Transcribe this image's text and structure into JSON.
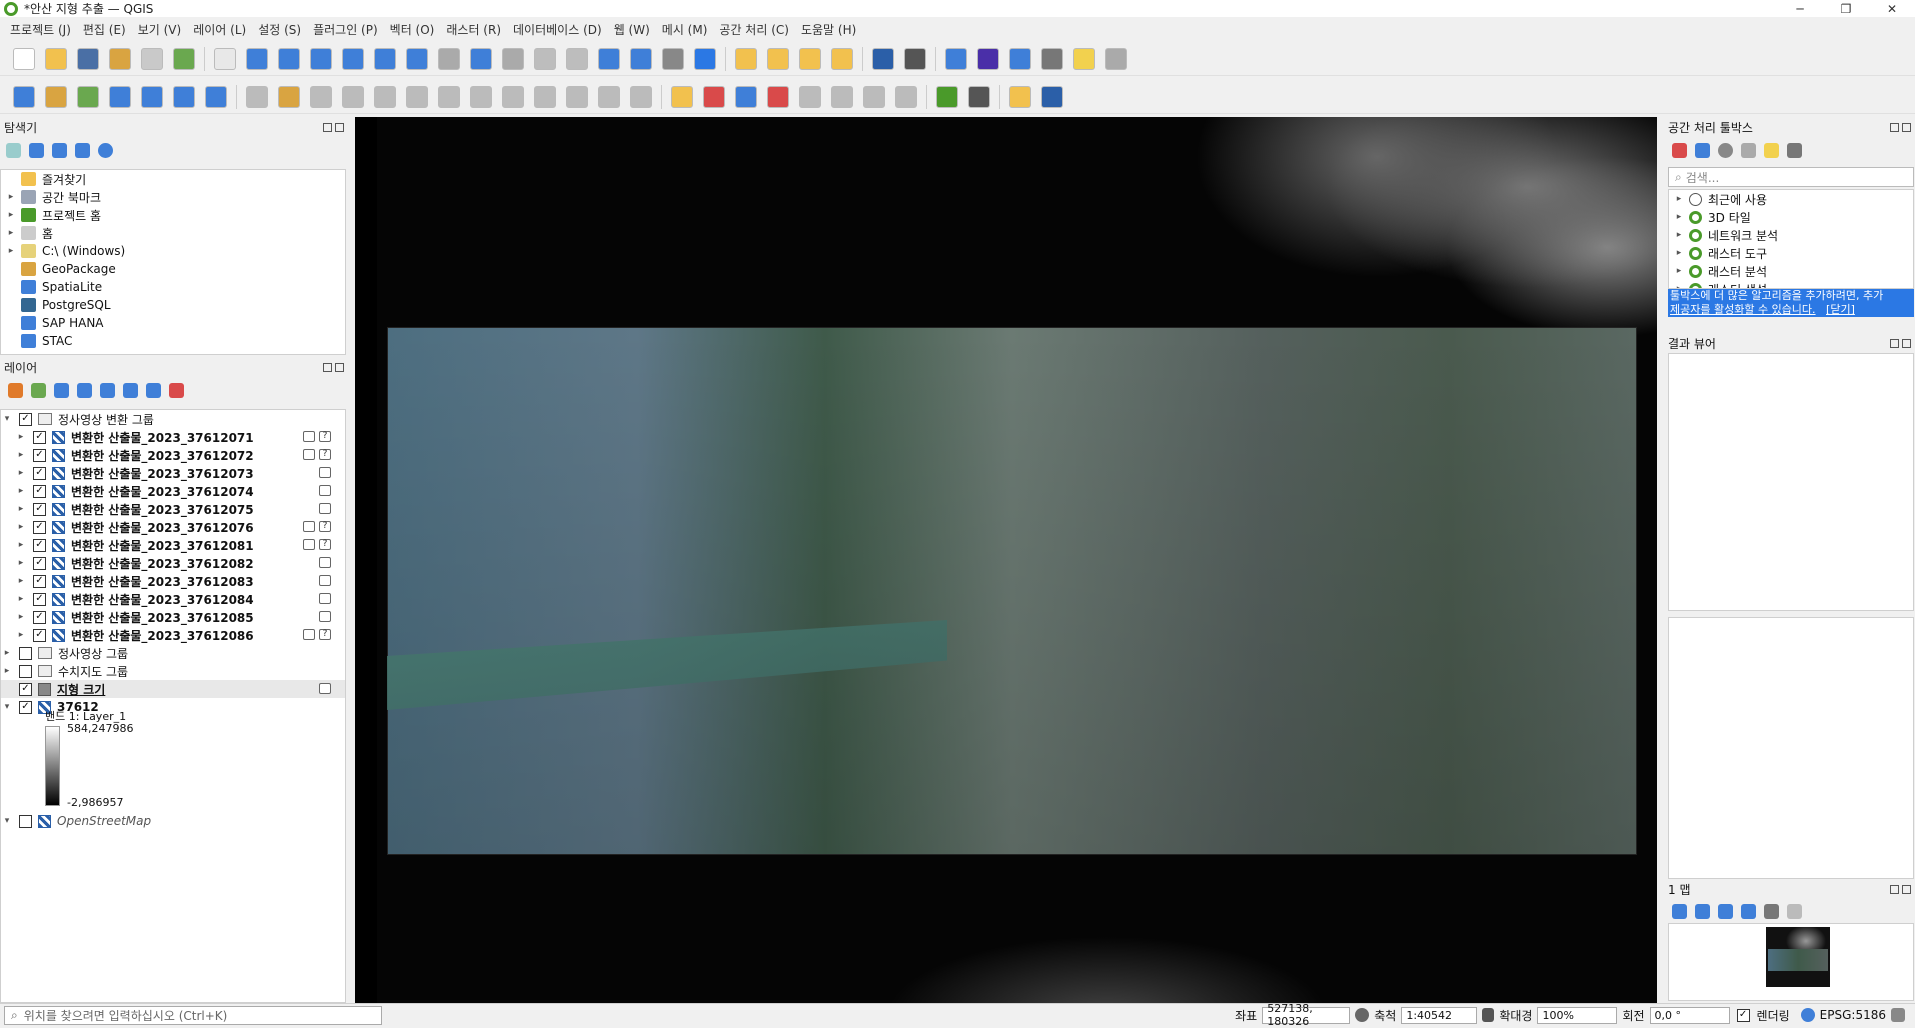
{
  "window": {
    "title": "*안산 지형 추출 — QGIS",
    "controls": [
      "─",
      "❐",
      "✕"
    ]
  },
  "menu": [
    {
      "label": "프로젝트 (J)"
    },
    {
      "label": "편집 (E)"
    },
    {
      "label": "보기 (V)"
    },
    {
      "label": "레이어 (L)"
    },
    {
      "label": "설정 (S)"
    },
    {
      "label": "플러그인 (P)"
    },
    {
      "label": "벡터 (O)"
    },
    {
      "label": "래스터 (R)"
    },
    {
      "label": "데이터베이스 (D)"
    },
    {
      "label": "웹 (W)"
    },
    {
      "label": "메시 (M)"
    },
    {
      "label": "공간 처리 (C)"
    },
    {
      "label": "도움말 (H)"
    }
  ],
  "toolbar1": [
    {
      "icon": "new-project-icon",
      "color": "#ffffff"
    },
    {
      "icon": "open-project-icon",
      "color": "#f2c14e"
    },
    {
      "icon": "save-project-icon",
      "color": "#4a6fa5"
    },
    {
      "icon": "new-print-layout-icon",
      "color": "#d9a441"
    },
    {
      "icon": "layout-manager-icon",
      "color": "#c9c9c9"
    },
    {
      "icon": "style-manager-icon",
      "color": "#6aa84f"
    },
    {
      "icon": "pan-icon",
      "color": "#e8e8e8"
    },
    {
      "icon": "pan-to-selection-icon",
      "color": "#3f7fd8"
    },
    {
      "icon": "zoom-in-icon",
      "color": "#3f7fd8"
    },
    {
      "icon": "zoom-out-icon",
      "color": "#3f7fd8"
    },
    {
      "icon": "zoom-full-icon",
      "color": "#3f7fd8"
    },
    {
      "icon": "zoom-selection-icon",
      "color": "#3f7fd8"
    },
    {
      "icon": "zoom-layer-icon",
      "color": "#3f7fd8"
    },
    {
      "icon": "zoom-native-icon",
      "color": "#aaaaaa"
    },
    {
      "icon": "zoom-last-icon",
      "color": "#3f7fd8"
    },
    {
      "icon": "zoom-next-icon",
      "color": "#aaaaaa"
    },
    {
      "icon": "new-map-view-icon",
      "color": "#bdbdbd"
    },
    {
      "icon": "new-3d-view-icon",
      "color": "#bdbdbd"
    },
    {
      "icon": "bookmark-new-icon",
      "color": "#3f7fd8"
    },
    {
      "icon": "bookmarks-icon",
      "color": "#3f7fd8"
    },
    {
      "icon": "temporal-icon",
      "color": "#888888"
    },
    {
      "icon": "refresh-icon",
      "color": "#2b78e4"
    },
    {
      "icon": "select-feature-icon",
      "color": "#f2c14e"
    },
    {
      "icon": "select-attribute-icon",
      "color": "#f2c14e"
    },
    {
      "icon": "deselect-icon",
      "color": "#f2c14e"
    },
    {
      "icon": "select-location-icon",
      "color": "#f2c14e"
    },
    {
      "icon": "identify-icon",
      "color": "#2b5fa8"
    },
    {
      "icon": "attribute-table-icon",
      "color": "#555555"
    },
    {
      "icon": "processing-settings-icon",
      "color": "#3f7fd8"
    },
    {
      "icon": "statistics-sigma-icon",
      "color": "#4a2fa8"
    },
    {
      "icon": "table-icon",
      "color": "#3f7fd8"
    },
    {
      "icon": "measure-icon",
      "color": "#777777"
    },
    {
      "icon": "map-tips-icon",
      "color": "#f2d14e"
    },
    {
      "icon": "locate-icon",
      "color": "#aaaaaa"
    }
  ],
  "toolbar2": [
    {
      "icon": "data-source-manager-icon",
      "color": "#3f7fd8"
    },
    {
      "icon": "new-geopackage-icon",
      "color": "#d9a441"
    },
    {
      "icon": "new-shapefile-icon",
      "color": "#6aa84f"
    },
    {
      "icon": "new-spatialite-icon",
      "color": "#3f7fd8"
    },
    {
      "icon": "new-temp-layer-icon",
      "color": "#3f7fd8"
    },
    {
      "icon": "add-raster-icon",
      "color": "#3f7fd8"
    },
    {
      "icon": "add-vector-icon",
      "color": "#3f7fd8"
    },
    {
      "icon": "digitize-icon",
      "color": "#bbbbbb"
    },
    {
      "icon": "toggle-edit-icon",
      "color": "#d9a441"
    },
    {
      "icon": "save-edits-icon",
      "color": "#bbbbbb"
    },
    {
      "icon": "add-feature-icon",
      "color": "#bbbbbb"
    },
    {
      "icon": "vertex-tool-icon",
      "color": "#bbbbbb"
    },
    {
      "icon": "move-feature-icon",
      "color": "#bbbbbb"
    },
    {
      "icon": "modify-attributes-icon",
      "color": "#bbbbbb"
    },
    {
      "icon": "delete-icon",
      "color": "#bbbbbb"
    },
    {
      "icon": "cut-icon",
      "color": "#bbbbbb"
    },
    {
      "icon": "copy-icon",
      "color": "#bbbbbb"
    },
    {
      "icon": "paste-icon",
      "color": "#bbbbbb"
    },
    {
      "icon": "undo-icon",
      "color": "#bbbbbb"
    },
    {
      "icon": "redo-icon",
      "color": "#bbbbbb"
    },
    {
      "icon": "label-icon",
      "color": "#f2c14e"
    },
    {
      "icon": "diagram-icon",
      "color": "#d94a4a"
    },
    {
      "icon": "label-pin-icon",
      "color": "#3f7fd8"
    },
    {
      "icon": "label-highlight-icon",
      "color": "#d94a4a"
    },
    {
      "icon": "label-show-icon",
      "color": "#bbbbbb"
    },
    {
      "icon": "label-move-icon",
      "color": "#bbbbbb"
    },
    {
      "icon": "label-rotate-icon",
      "color": "#bbbbbb"
    },
    {
      "icon": "label-change-icon",
      "color": "#bbbbbb"
    },
    {
      "icon": "gdal-icon",
      "color": "#4a9a2a"
    },
    {
      "icon": "grass-icon",
      "color": "#555555"
    },
    {
      "icon": "python-icon",
      "color": "#f2c14e"
    },
    {
      "icon": "help-icon",
      "color": "#2b5fa8"
    }
  ],
  "browser": {
    "title": "탐색기",
    "items": [
      {
        "label": "즐겨찾기",
        "icon": "star-icon",
        "color": "#f2c14e",
        "expand": ""
      },
      {
        "label": "공간 북마크",
        "icon": "bookmark-icon",
        "color": "#9aa4b5",
        "expand": "▸"
      },
      {
        "label": "프로젝트 홈",
        "icon": "project-home-icon",
        "color": "#4a9a2a",
        "expand": "▸"
      },
      {
        "label": "홈",
        "icon": "home-folder-icon",
        "color": "#cccccc",
        "expand": "▸"
      },
      {
        "label": "C:\\ (Windows)",
        "icon": "drive-icon",
        "color": "#e6d27a",
        "expand": "▸"
      },
      {
        "label": "GeoPackage",
        "icon": "geopackage-icon",
        "color": "#d9a441",
        "expand": ""
      },
      {
        "label": "SpatiaLite",
        "icon": "spatialite-icon",
        "color": "#3f7fd8",
        "expand": ""
      },
      {
        "label": "PostgreSQL",
        "icon": "postgresql-icon",
        "color": "#336791",
        "expand": ""
      },
      {
        "label": "SAP HANA",
        "icon": "sap-hana-icon",
        "color": "#3f7fd8",
        "expand": ""
      },
      {
        "label": "STAC",
        "icon": "stac-icon",
        "color": "#3f7fd8",
        "expand": ""
      }
    ]
  },
  "layers_panel": {
    "title": "레이어",
    "group_ortho_converted": "정사영상 변환 그룹",
    "converted_layers": [
      {
        "label": "변환한 산출물_2023_37612071",
        "query": true
      },
      {
        "label": "변환한 산출물_2023_37612072",
        "query": true
      },
      {
        "label": "변환한 산출물_2023_37612073",
        "query": false
      },
      {
        "label": "변환한 산출물_2023_37612074",
        "query": false
      },
      {
        "label": "변환한 산출물_2023_37612075",
        "query": false
      },
      {
        "label": "변환한 산출물_2023_37612076",
        "query": true
      },
      {
        "label": "변환한 산출물_2023_37612081",
        "query": true
      },
      {
        "label": "변환한 산출물_2023_37612082",
        "query": false
      },
      {
        "label": "변환한 산출물_2023_37612083",
        "query": false
      },
      {
        "label": "변환한 산출물_2023_37612084",
        "query": false
      },
      {
        "label": "변환한 산출물_2023_37612085",
        "query": false
      },
      {
        "label": "변환한 산출물_2023_37612086",
        "query": true
      }
    ],
    "group_ortho": "정사영상 그룹",
    "group_numeric_map": "수치지도 그룹",
    "layer_terrain": "지형 크기",
    "layer_dem": "37612",
    "band_label": "밴드 1: Layer_1",
    "band_max": "584,247986",
    "band_min": "-2,986957",
    "layer_osm": "OpenStreetMap"
  },
  "processing": {
    "title": "공간 처리 툴박스",
    "search_placeholder": "검색...",
    "items": [
      {
        "label": "최근에 사용",
        "icon": "clock-icon"
      },
      {
        "label": "3D 타일",
        "icon": "qgis-algorithm-icon"
      },
      {
        "label": "네트워크 분석",
        "icon": "qgis-algorithm-icon"
      },
      {
        "label": "래스터 도구",
        "icon": "qgis-algorithm-icon"
      },
      {
        "label": "래스터 분석",
        "icon": "qgis-algorithm-icon"
      },
      {
        "label": "래스터 생성",
        "icon": "qgis-algorithm-icon"
      }
    ],
    "info_line1": "툴박스에 더 많은 알고리즘을 추가하려면, 추가",
    "info_line2": "제공자를 활성화할 수 있습니다.",
    "info_close": "[닫기]"
  },
  "results_viewer": {
    "title": "결과 뷰어"
  },
  "overview": {
    "title": "1 맵"
  },
  "statusbar": {
    "locator_placeholder": "위치를 찾으려면 입력하십시오 (Ctrl+K)",
    "coord_label": "좌표",
    "coord_value": "527138, 180326",
    "scale_label": "축척",
    "scale_value": "1:40542",
    "magnifier_label": "확대경",
    "magnifier_value": "100%",
    "rotation_label": "회전",
    "rotation_value": "0,0 °",
    "render_label": "렌더링",
    "crs": "EPSG:5186"
  }
}
